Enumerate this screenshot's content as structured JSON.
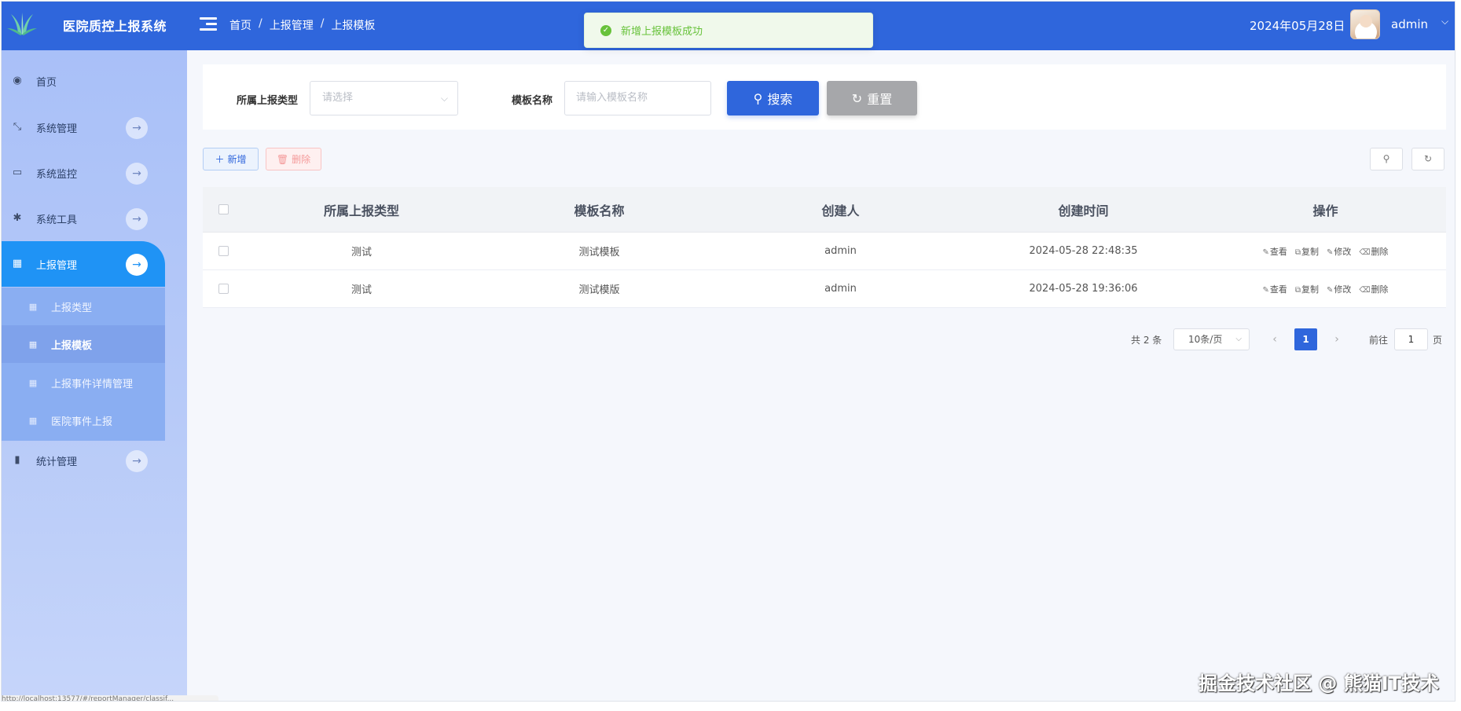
{
  "header": {
    "app_title": "医院质控上报系统",
    "breadcrumb": [
      "首页",
      "上报管理",
      "上报模板"
    ],
    "breadcrumb_sep": "/",
    "date": "2024年05月28日",
    "username": "admin"
  },
  "toast": {
    "message": "新增上报模板成功"
  },
  "sidebar": {
    "items": [
      {
        "label": "首页",
        "icon": "dashboard-icon"
      },
      {
        "label": "系统管理",
        "icon": "compress-icon"
      },
      {
        "label": "系统监控",
        "icon": "monitor-icon"
      },
      {
        "label": "系统工具",
        "icon": "bug-icon"
      },
      {
        "label": "上报管理",
        "icon": "table-icon"
      },
      {
        "label": "统计管理",
        "icon": "chart-icon"
      }
    ],
    "subitems": [
      {
        "label": "上报类型"
      },
      {
        "label": "上报模板"
      },
      {
        "label": "上报事件详情管理"
      },
      {
        "label": "医院事件上报"
      }
    ]
  },
  "search": {
    "type_label": "所属上报类型",
    "type_placeholder": "请选择",
    "name_label": "模板名称",
    "name_placeholder": "请输入模板名称",
    "search_button": "搜索",
    "reset_button": "重置"
  },
  "toolbar": {
    "add_label": "新增",
    "delete_label": "删除"
  },
  "table": {
    "columns": [
      "所属上报类型",
      "模板名称",
      "创建人",
      "创建时间",
      "操作"
    ],
    "rows": [
      {
        "type": "测试",
        "name": "测试模板",
        "creator": "admin",
        "created": "2024-05-28 22:48:35"
      },
      {
        "type": "测试",
        "name": "测试模版",
        "creator": "admin",
        "created": "2024-05-28 19:36:06"
      }
    ],
    "actions": [
      "查看",
      "复制",
      "修改",
      "删除"
    ]
  },
  "pagination": {
    "total_text": "共 2 条",
    "page_size": "10条/页",
    "current_page": "1",
    "goto_prefix": "前往",
    "goto_value": "1",
    "goto_suffix": "页"
  },
  "status_bar": {
    "url": "http://localhost:13577/#/reportManager/classif..."
  },
  "watermark": "掘金技术社区 @ 熊猫IT技术",
  "colors": {
    "primary": "#2f66dc",
    "success": "#67c23a",
    "danger": "#f56c6c",
    "sidebar_active": "#1f93f5"
  }
}
